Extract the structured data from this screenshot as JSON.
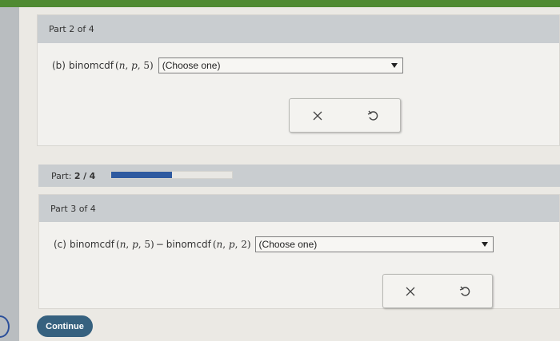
{
  "part2": {
    "header": "Part 2 of 4",
    "label": "(b)",
    "fn": "binomcdf",
    "args": [
      "n",
      "p",
      "5"
    ],
    "select_value": "(Choose one)"
  },
  "progress": {
    "label": "Part:",
    "current": "2",
    "sep": "/",
    "total": "4",
    "fraction": 0.5
  },
  "part3": {
    "header": "Part 3 of 4",
    "label": "(c)",
    "fn": "binomcdf",
    "args1": [
      "n",
      "p",
      "5"
    ],
    "minus": "−",
    "fn2": "binomcdf",
    "args2": [
      "n",
      "p",
      "2"
    ],
    "select_value": "(Choose one)"
  },
  "actions": {
    "clear_icon": "x-icon",
    "undo_icon": "undo-icon"
  },
  "continue_label": "Continue",
  "colors": {
    "header_bg": "#c9cdd0",
    "progress_fill": "#2e5aa0",
    "continue_bg": "#36617f",
    "top_strip": "#4f8a32"
  }
}
